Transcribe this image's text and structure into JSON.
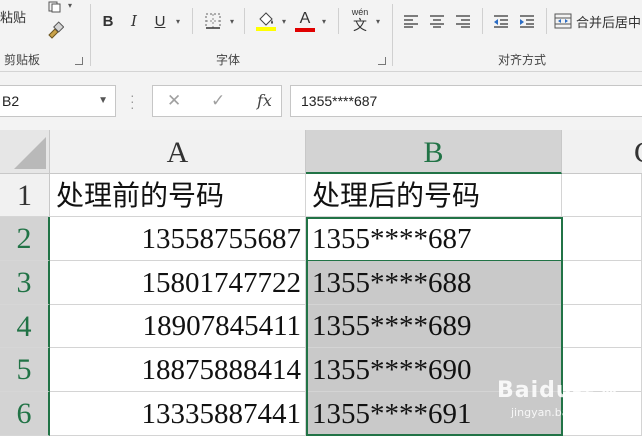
{
  "ribbon": {
    "clipboard": {
      "paste_label": "粘贴",
      "group_label": "剪贴板"
    },
    "font": {
      "group_label": "字体",
      "bold": "B",
      "italic": "I",
      "underline": "U",
      "font_color_letter": "A",
      "phonetic_label": "wén",
      "phonetic_char": "文"
    },
    "alignment": {
      "group_label": "对齐方式",
      "merge_label": "合并后居中"
    },
    "colors": {
      "fill_color": "#ffff00",
      "font_color": "#e00000"
    }
  },
  "formula_bar": {
    "name_box": "B2",
    "fx_label": "fx",
    "value": "1355****687"
  },
  "sheet": {
    "columns": [
      "A",
      "B",
      "C"
    ],
    "rows": [
      "1",
      "2",
      "3",
      "4",
      "5",
      "6"
    ],
    "header_row": {
      "a": "处理前的号码",
      "b": "处理后的号码"
    },
    "data": [
      {
        "a": "13558755687",
        "b": "1355****687"
      },
      {
        "a": "15801747722",
        "b": "1355****688"
      },
      {
        "a": "18907845411",
        "b": "1355****689"
      },
      {
        "a": "18875888414",
        "b": "1355****690"
      },
      {
        "a": "13335887441",
        "b": "1355****691"
      }
    ],
    "active_cell": "B2",
    "selection_color": "#217346"
  },
  "watermark": {
    "brand": "Baidu经验",
    "url": "jingyan.baidu.com"
  }
}
